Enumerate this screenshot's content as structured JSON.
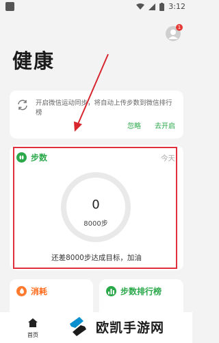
{
  "status_bar": {
    "time": "3:12"
  },
  "avatar": {
    "badge": "1"
  },
  "page": {
    "title": "健康"
  },
  "sync_card": {
    "text": "开启微信运动同步，将自动上传步数到微信排行榜",
    "ignore": "忽略",
    "enable": "去开启"
  },
  "steps_card": {
    "title": "步数",
    "period": "今天",
    "steps": "0",
    "goal": "8000步",
    "remaining": "还差8000步达成目标，加油"
  },
  "burn_card": {
    "title": "消耗"
  },
  "rank_card": {
    "title": "步数排行榜"
  },
  "bottom_nav": {
    "home": "首页"
  },
  "watermark": {
    "text": "欧凯手游网"
  },
  "colors": {
    "accent": "#2aa84a",
    "orange": "#ff6a1a",
    "highlight": "#e0303c"
  }
}
